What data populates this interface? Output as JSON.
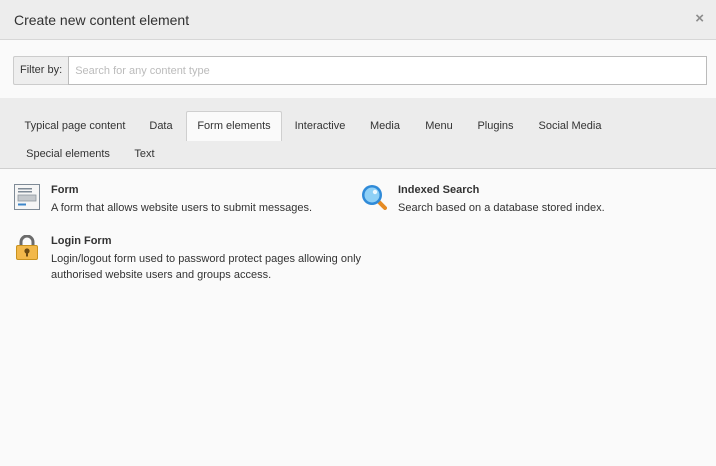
{
  "modal": {
    "title": "Create new content element",
    "close_label": "×"
  },
  "filter": {
    "label": "Filter by:",
    "placeholder": "Search for any content type",
    "value": ""
  },
  "tabs": [
    {
      "label": "Typical page content",
      "active": false
    },
    {
      "label": "Data",
      "active": false
    },
    {
      "label": "Form elements",
      "active": true
    },
    {
      "label": "Interactive",
      "active": false
    },
    {
      "label": "Media",
      "active": false
    },
    {
      "label": "Menu",
      "active": false
    },
    {
      "label": "Plugins",
      "active": false
    },
    {
      "label": "Social Media",
      "active": false
    },
    {
      "label": "Special elements",
      "active": false
    },
    {
      "label": "Text",
      "active": false
    }
  ],
  "elements": [
    {
      "title": "Form",
      "description": "A form that allows website users to submit messages.",
      "icon": "form-icon"
    },
    {
      "title": "Indexed Search",
      "description": "Search based on a database stored index.",
      "icon": "magnifier-icon"
    },
    {
      "title": "Login Form",
      "description": "Login/logout form used to password protect pages allowing only authorised website users and groups access.",
      "icon": "padlock-icon"
    }
  ]
}
